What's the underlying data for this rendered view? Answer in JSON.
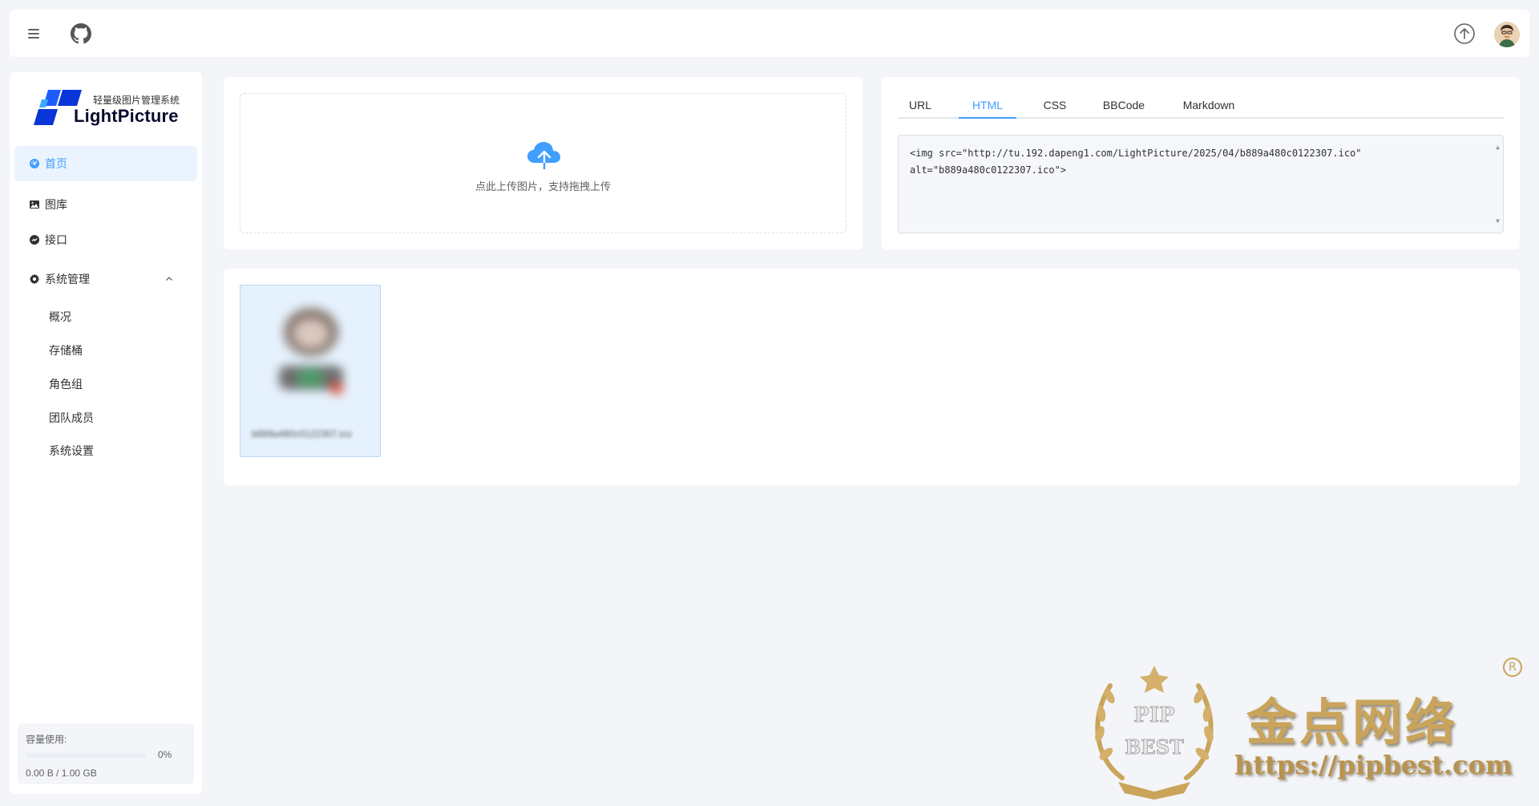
{
  "header": {
    "menu_icon": "hamburger-menu-icon",
    "github_icon": "github-icon",
    "upload_icon": "upload-circle-icon",
    "avatar_icon": "user-avatar"
  },
  "sidebar": {
    "logo_tagline": "轻量级图片管理系统",
    "logo_name": "LightPicture",
    "items": [
      {
        "label": "首页",
        "icon": "dashboard-icon",
        "active": true
      },
      {
        "label": "图库",
        "icon": "picture-icon",
        "active": false
      },
      {
        "label": "接口",
        "icon": "api-icon",
        "active": false
      },
      {
        "label": "系统管理",
        "icon": "gear-icon",
        "active": false,
        "expanded": true
      }
    ],
    "sub_items": [
      {
        "label": "概况"
      },
      {
        "label": "存储桶"
      },
      {
        "label": "角色组"
      },
      {
        "label": "团队成员"
      },
      {
        "label": "系统设置"
      }
    ],
    "usage": {
      "label": "容量使用:",
      "percent_text": "0%",
      "percent": 0,
      "amount": "0.00 B / 1.00 GB"
    }
  },
  "upload": {
    "icon": "cloud-upload-icon",
    "hint": "点此上传图片，支持拖拽上传"
  },
  "code": {
    "tabs": [
      {
        "label": "URL",
        "active": false
      },
      {
        "label": "HTML",
        "active": true
      },
      {
        "label": "CSS",
        "active": false
      },
      {
        "label": "BBCode",
        "active": false
      },
      {
        "label": "Markdown",
        "active": false
      }
    ],
    "line1": "<img src=\"http://tu.192.dapeng1.com/LightPicture/2025/04/b889a480c0122307.ico\"",
    "line2": "alt=\"b889a480c0122307.ico\">"
  },
  "gallery": {
    "items": [
      {
        "filename": "b889a480c0122307.ico"
      }
    ]
  },
  "watermark": {
    "badge_top": "PIP",
    "badge_bottom": "BEST",
    "title": "金点网络",
    "url": "https://pipbest.com",
    "reg": "R"
  },
  "colors": {
    "accent": "#409eff",
    "background": "#f3f5f8",
    "active_bg": "#ebf4fe",
    "watermark_gold": "#c9a45a"
  }
}
